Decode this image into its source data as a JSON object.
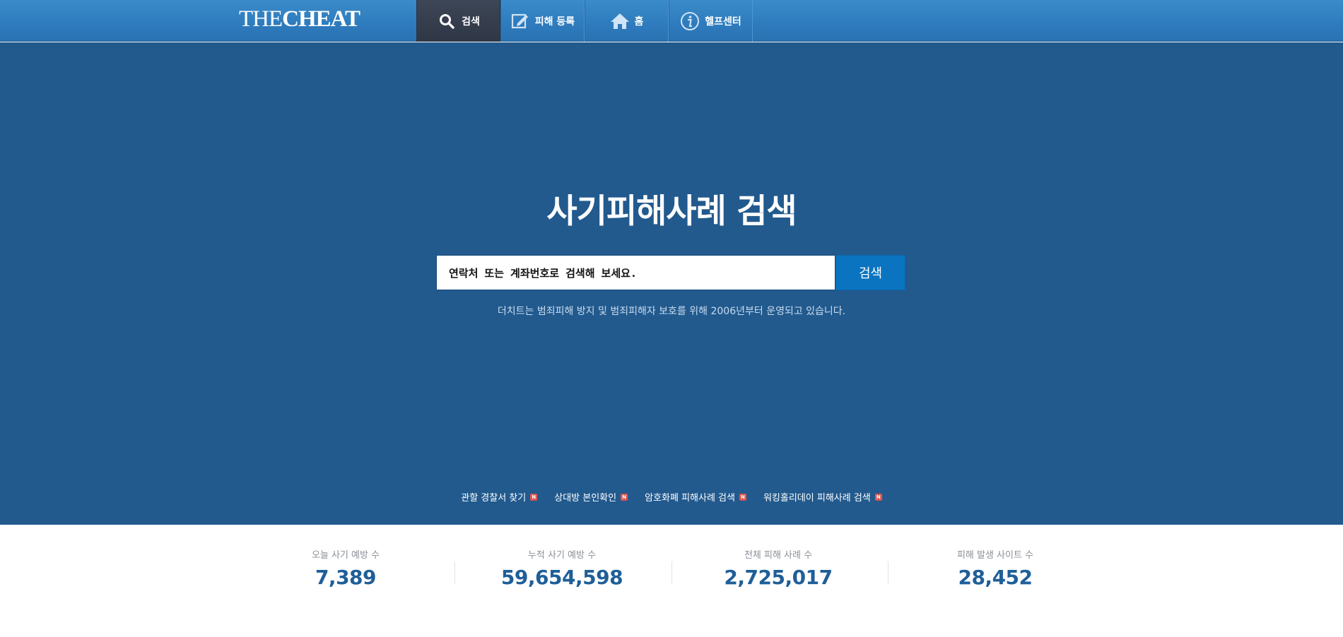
{
  "header": {
    "logo_thin": "THE",
    "logo_bold": "CHEAT",
    "nav": [
      {
        "label": "검색",
        "icon": "search-icon",
        "active": true
      },
      {
        "label": "피해 등록",
        "icon": "edit-icon",
        "active": false
      },
      {
        "label": "홈",
        "icon": "home-icon",
        "active": false
      },
      {
        "label": "헬프센터",
        "icon": "info-icon",
        "active": false
      }
    ]
  },
  "hero": {
    "title": "사기피해사례 검색",
    "search": {
      "value": "연락처 또는 계좌번호로 검색해 보세요.",
      "button_label": "검색"
    },
    "note": "더치트는 범죄피해 방지 및 범죄피해자 보호를 위해 2006년부터 운영되고 있습니다.",
    "quick_links": [
      {
        "label": "관할 경찰서 찾기",
        "badge": "N"
      },
      {
        "label": "상대방 본인확인",
        "badge": "N"
      },
      {
        "label": "암호화폐 피해사례 검색",
        "badge": "N"
      },
      {
        "label": "워킹홀리데이 피해사례 검색",
        "badge": "N"
      }
    ]
  },
  "stats": [
    {
      "label": "오늘 사기 예방 수",
      "value": "7,389"
    },
    {
      "label": "누적 사기 예방 수",
      "value": "59,654,598"
    },
    {
      "label": "전체 피해 사례 수",
      "value": "2,725,017"
    },
    {
      "label": "피해 발생 사이트 수",
      "value": "28,452"
    }
  ],
  "colors": {
    "header_blue": "#2e7bbd",
    "hero_blue": "#225a8e",
    "active_tab": "#353d4c",
    "search_button": "#0a74c0",
    "stat_value": "#1f5f98"
  }
}
